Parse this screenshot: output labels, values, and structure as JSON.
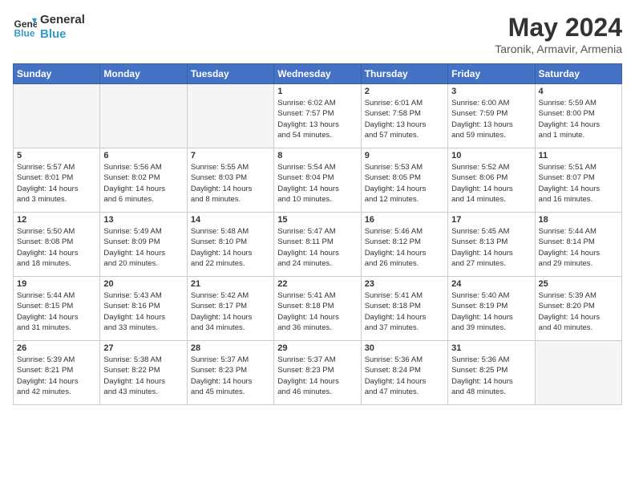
{
  "header": {
    "logo_line1": "General",
    "logo_line2": "Blue",
    "month_year": "May 2024",
    "location": "Taronik, Armavir, Armenia"
  },
  "columns": [
    "Sunday",
    "Monday",
    "Tuesday",
    "Wednesday",
    "Thursday",
    "Friday",
    "Saturday"
  ],
  "weeks": [
    [
      {
        "day": "",
        "info": "",
        "empty": true
      },
      {
        "day": "",
        "info": "",
        "empty": true
      },
      {
        "day": "",
        "info": "",
        "empty": true
      },
      {
        "day": "1",
        "info": "Sunrise: 6:02 AM\nSunset: 7:57 PM\nDaylight: 13 hours\nand 54 minutes."
      },
      {
        "day": "2",
        "info": "Sunrise: 6:01 AM\nSunset: 7:58 PM\nDaylight: 13 hours\nand 57 minutes."
      },
      {
        "day": "3",
        "info": "Sunrise: 6:00 AM\nSunset: 7:59 PM\nDaylight: 13 hours\nand 59 minutes."
      },
      {
        "day": "4",
        "info": "Sunrise: 5:59 AM\nSunset: 8:00 PM\nDaylight: 14 hours\nand 1 minute."
      }
    ],
    [
      {
        "day": "5",
        "info": "Sunrise: 5:57 AM\nSunset: 8:01 PM\nDaylight: 14 hours\nand 3 minutes."
      },
      {
        "day": "6",
        "info": "Sunrise: 5:56 AM\nSunset: 8:02 PM\nDaylight: 14 hours\nand 6 minutes."
      },
      {
        "day": "7",
        "info": "Sunrise: 5:55 AM\nSunset: 8:03 PM\nDaylight: 14 hours\nand 8 minutes."
      },
      {
        "day": "8",
        "info": "Sunrise: 5:54 AM\nSunset: 8:04 PM\nDaylight: 14 hours\nand 10 minutes."
      },
      {
        "day": "9",
        "info": "Sunrise: 5:53 AM\nSunset: 8:05 PM\nDaylight: 14 hours\nand 12 minutes."
      },
      {
        "day": "10",
        "info": "Sunrise: 5:52 AM\nSunset: 8:06 PM\nDaylight: 14 hours\nand 14 minutes."
      },
      {
        "day": "11",
        "info": "Sunrise: 5:51 AM\nSunset: 8:07 PM\nDaylight: 14 hours\nand 16 minutes."
      }
    ],
    [
      {
        "day": "12",
        "info": "Sunrise: 5:50 AM\nSunset: 8:08 PM\nDaylight: 14 hours\nand 18 minutes."
      },
      {
        "day": "13",
        "info": "Sunrise: 5:49 AM\nSunset: 8:09 PM\nDaylight: 14 hours\nand 20 minutes."
      },
      {
        "day": "14",
        "info": "Sunrise: 5:48 AM\nSunset: 8:10 PM\nDaylight: 14 hours\nand 22 minutes."
      },
      {
        "day": "15",
        "info": "Sunrise: 5:47 AM\nSunset: 8:11 PM\nDaylight: 14 hours\nand 24 minutes."
      },
      {
        "day": "16",
        "info": "Sunrise: 5:46 AM\nSunset: 8:12 PM\nDaylight: 14 hours\nand 26 minutes."
      },
      {
        "day": "17",
        "info": "Sunrise: 5:45 AM\nSunset: 8:13 PM\nDaylight: 14 hours\nand 27 minutes."
      },
      {
        "day": "18",
        "info": "Sunrise: 5:44 AM\nSunset: 8:14 PM\nDaylight: 14 hours\nand 29 minutes."
      }
    ],
    [
      {
        "day": "19",
        "info": "Sunrise: 5:44 AM\nSunset: 8:15 PM\nDaylight: 14 hours\nand 31 minutes."
      },
      {
        "day": "20",
        "info": "Sunrise: 5:43 AM\nSunset: 8:16 PM\nDaylight: 14 hours\nand 33 minutes."
      },
      {
        "day": "21",
        "info": "Sunrise: 5:42 AM\nSunset: 8:17 PM\nDaylight: 14 hours\nand 34 minutes."
      },
      {
        "day": "22",
        "info": "Sunrise: 5:41 AM\nSunset: 8:18 PM\nDaylight: 14 hours\nand 36 minutes."
      },
      {
        "day": "23",
        "info": "Sunrise: 5:41 AM\nSunset: 8:18 PM\nDaylight: 14 hours\nand 37 minutes."
      },
      {
        "day": "24",
        "info": "Sunrise: 5:40 AM\nSunset: 8:19 PM\nDaylight: 14 hours\nand 39 minutes."
      },
      {
        "day": "25",
        "info": "Sunrise: 5:39 AM\nSunset: 8:20 PM\nDaylight: 14 hours\nand 40 minutes."
      }
    ],
    [
      {
        "day": "26",
        "info": "Sunrise: 5:39 AM\nSunset: 8:21 PM\nDaylight: 14 hours\nand 42 minutes."
      },
      {
        "day": "27",
        "info": "Sunrise: 5:38 AM\nSunset: 8:22 PM\nDaylight: 14 hours\nand 43 minutes."
      },
      {
        "day": "28",
        "info": "Sunrise: 5:37 AM\nSunset: 8:23 PM\nDaylight: 14 hours\nand 45 minutes."
      },
      {
        "day": "29",
        "info": "Sunrise: 5:37 AM\nSunset: 8:23 PM\nDaylight: 14 hours\nand 46 minutes."
      },
      {
        "day": "30",
        "info": "Sunrise: 5:36 AM\nSunset: 8:24 PM\nDaylight: 14 hours\nand 47 minutes."
      },
      {
        "day": "31",
        "info": "Sunrise: 5:36 AM\nSunset: 8:25 PM\nDaylight: 14 hours\nand 48 minutes."
      },
      {
        "day": "",
        "info": "",
        "empty": true
      }
    ]
  ]
}
